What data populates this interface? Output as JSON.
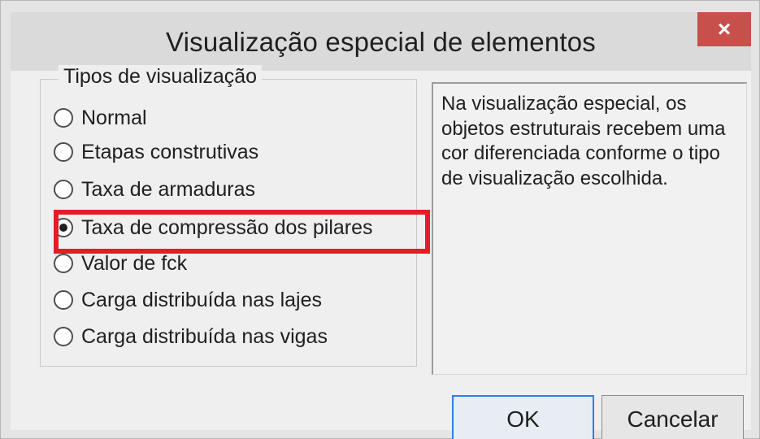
{
  "window": {
    "title": "Visualização especial de elementos",
    "close_label": "×"
  },
  "group": {
    "title": "Tipos de visualização",
    "options": [
      {
        "label": "Normal",
        "checked": false
      },
      {
        "label": "Etapas construtivas",
        "checked": false
      },
      {
        "label": "Taxa de armaduras",
        "checked": false
      },
      {
        "label": "Taxa de compressão dos pilares",
        "checked": true
      },
      {
        "label": "Valor de fck",
        "checked": false
      },
      {
        "label": "Carga distribuída nas lajes",
        "checked": false
      },
      {
        "label": "Carga distribuída nas vigas",
        "checked": false
      }
    ]
  },
  "description": {
    "text": "Na visualização especial, os objetos estruturais recebem uma cor diferenciada conforme o tipo de visualização escolhida."
  },
  "buttons": {
    "ok": "OK",
    "cancel": "Cancelar"
  },
  "colors": {
    "highlight": "#e31c25",
    "close": "#c7504b",
    "default_button_border": "#2f7fe3"
  }
}
